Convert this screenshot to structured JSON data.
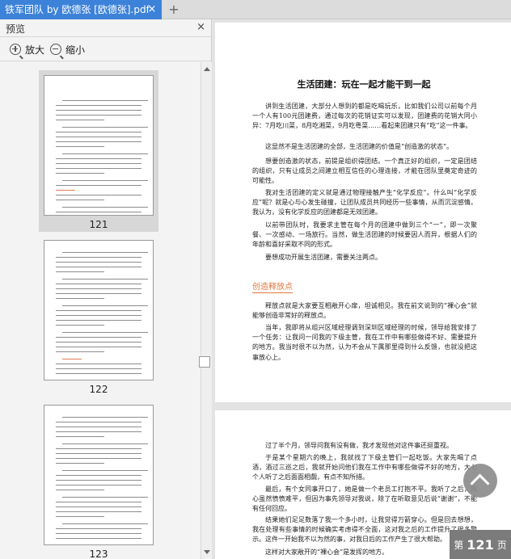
{
  "tab": {
    "title": "铁军团队 by 欧德张 [欧德张].pdf",
    "close": "×",
    "new": "+"
  },
  "sidebar": {
    "title": "预览",
    "close": "×",
    "zoom_in": "放大",
    "zoom_out": "缩小",
    "thumbnails": [
      {
        "page": "121",
        "selected": true
      },
      {
        "page": "122",
        "selected": false
      },
      {
        "page": "123",
        "selected": false
      }
    ]
  },
  "document": {
    "title": "生活团建：玩在一起才能干到一起",
    "paragraphs_top": [
      "讲到生活团建，大部分人想到的都是吃喝玩乐，比如我们公司以前每个月一个人有100元团建费，通过每次的花销证实可以发现，团建费的花销大同小异：7月吃川菜，8月吃湘菜，9月吃粤菜……看起来团建只有“吃”这一件事。",
      "这显然不是生活团建的全部，生活团建的价值是“创造激的状态”。",
      "想要创造激的状态，前提是组织得团结。一个真正好的组织，一定是团结的组织，只有让成员之间建立相互信任的心理连接，才能在团队里奠定奇迹的可能性。",
      "我对生活团建的定义就是通过物理接触产生“化学反应”。什么叫“化学反应”呢？就是心与心发生碰撞，让团队成员共同经历一些事情，从而沉淀感情。我认为，没有化学反应的团建都是无效团建。",
      "以前带团队时，我要求主管在每个月的团建中做到三个“一”，即一次聚餐、一次感动、一场旅行。当然，做生活团建的时候要因人而异，根据人们的年龄和喜好采取不同的形式。",
      "要想成功开展生活团建，需要关注两点。"
    ],
    "section_heading": "创造释放点",
    "paragraphs_mid": [
      "释放点就是大家要互相敞开心扉，坦诚相见。我在前文说到的“裸心会”就能够创造非常好的释放点。",
      "当年，我即将从组兴区域经理调到深圳区域经理的时候，领导给我安排了一个任务：让我问一问我的下级主管，我在工作中有哪些做得不好、需要提升的地方。我当时很不以为然，认为不会从下属那里得到什么反馈，也就没把这事放心上。"
    ],
    "paragraphs_page2": [
      "过了半个月，领导问我有没有做，我才发现他对这件事还挺重视。",
      "于是某个星期六的晚上，我就找了下级主管们一起吃饭。大家先喝了点酒，酒过三巡之后，我就开始问他们我在工作中有哪些做得不好的地方，大七个人听了之后面面相觑，有点不知所措。",
      "最后，有个女同事开口了，她是做一个老员工打抱不平。我听了之后，内心虽然愤愤难平，但因为事先领导对我说，除了在听取意见后说“谢谢”，不能有任何回应。",
      "结果她们足足数落了我一个多小时，让我觉得万箭穿心。但是回去想想，我在处理有些事情的时候确实考虑得不全面，这对我之后的工作提升了很多警示。这件一开始我不以为然的事，对我日后的工作产生了很大帮助。",
      "这样对大家敞开的“裸心会”是发挥的地方。"
    ]
  },
  "page_indicator": {
    "prefix": "第",
    "number": "121",
    "suffix": "页"
  }
}
